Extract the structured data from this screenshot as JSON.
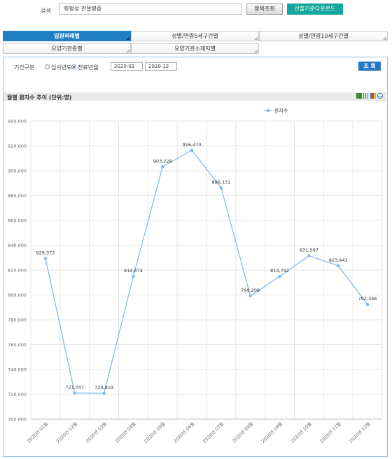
{
  "search": {
    "label": "검색",
    "value": "회평성 관절병증"
  },
  "buttons": {
    "category_search": "항목조회",
    "download": "산출기준다운로드",
    "query": "조 회"
  },
  "tabs": [
    {
      "label": "입원외래별",
      "active": true
    },
    {
      "label": "성별/연령5세구간별",
      "active": false
    },
    {
      "label": "성별/연령10세구간별",
      "active": false
    },
    {
      "label": "요양기관종별",
      "active": false
    },
    {
      "label": "요양기관소재지별",
      "active": false
    }
  ],
  "filter": {
    "period_label": "기간구분",
    "options": [
      {
        "label": "심사년도",
        "selected": false
      },
      {
        "label": "진료년월",
        "selected": true
      }
    ],
    "start": "2020-01",
    "end": "2020-12"
  },
  "chart_header": {
    "title": "월별 환자수 추이 (단위:명)",
    "icons": [
      "excel-icon",
      "bar-chart-icon",
      "column-chart-icon",
      "collapse-icon"
    ]
  },
  "colors": {
    "accent": "#1f7fc2",
    "teal": "#14a79d",
    "series": "#7cb5ec"
  },
  "chart_data": {
    "type": "line",
    "title": "월별 환자수 추이 (단위:명)",
    "categories": [
      "2020년 01월",
      "2020년 02월",
      "2020년 03월",
      "2020년 04월",
      "2020년 05월",
      "2020년 06월",
      "2020년 07월",
      "2020년 08월",
      "2020년 09월",
      "2020년 10월",
      "2020년 11월",
      "2020년 12월"
    ],
    "series": [
      {
        "name": "환자수",
        "values": [
          829372,
          721047,
          720819,
          814874,
          903228,
          916470,
          886131,
          799208,
          814792,
          831567,
          823443,
          792346
        ]
      }
    ],
    "data_labels": [
      "829,372",
      "721,047",
      "720,819",
      "814,874",
      "903,228",
      "916,470",
      "886,131",
      "799,208",
      "814,792",
      "831,567",
      "823,443",
      "792,346"
    ],
    "ylim": [
      700000,
      940000
    ],
    "yticks": [
      "700,000",
      "720,000",
      "740,000",
      "760,000",
      "780,000",
      "800,000",
      "820,000",
      "840,000",
      "860,000",
      "880,000",
      "900,000",
      "920,000",
      "940,000"
    ],
    "grid": true,
    "legend": "top-center"
  }
}
